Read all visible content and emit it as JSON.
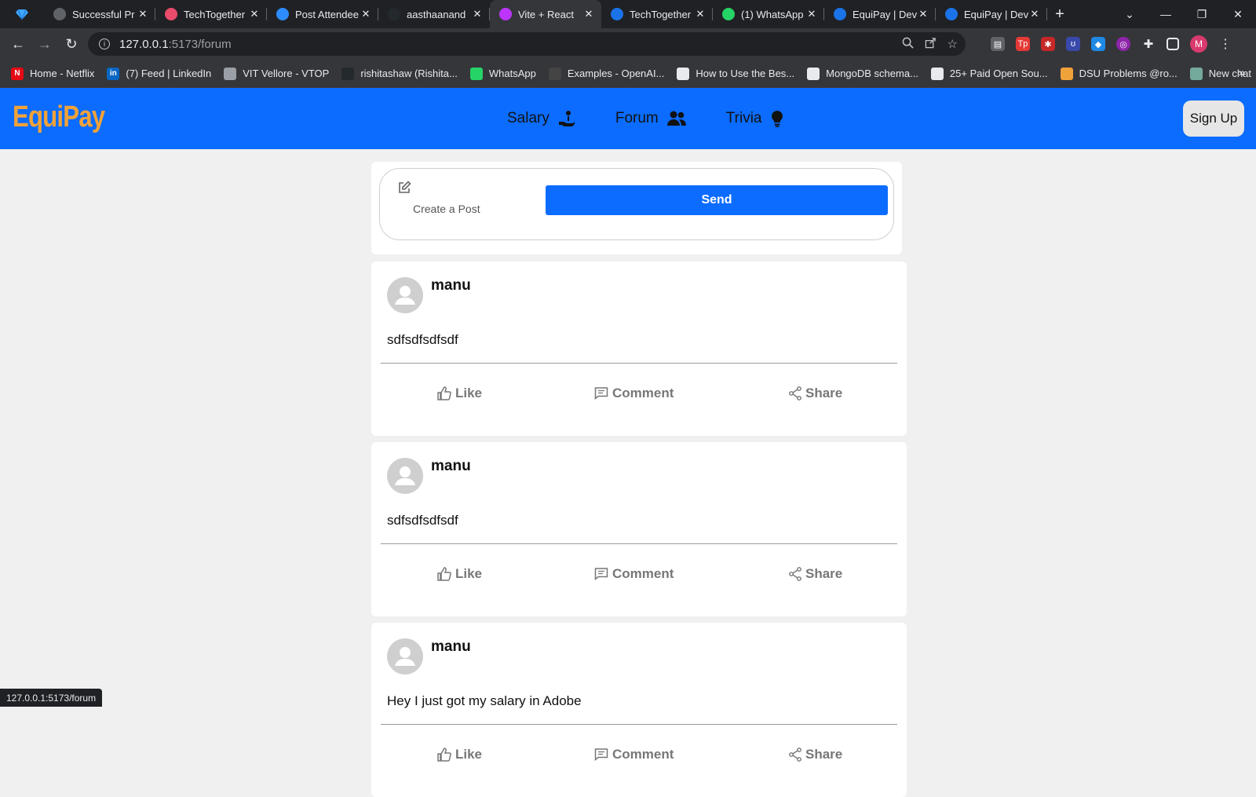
{
  "browser": {
    "tabs": [
      {
        "title": "Successful Pr",
        "fav_color": "#5f6368",
        "icon": "globe-icon"
      },
      {
        "title": "TechTogether",
        "fav_color": "#e94b6a",
        "icon": "techtogether-icon"
      },
      {
        "title": "Post Attendee",
        "fav_color": "#2d8cff",
        "icon": "zoom-icon"
      },
      {
        "title": "aasthaanand",
        "fav_color": "#24292e",
        "icon": "github-icon"
      },
      {
        "title": "Vite + React",
        "fav_color": "#bd34fe",
        "icon": "vite-icon",
        "active": true
      },
      {
        "title": "TechTogether",
        "fav_color": "#1a73e8",
        "icon": "devpost-icon"
      },
      {
        "title": "(1) WhatsApp",
        "fav_color": "#25d366",
        "icon": "whatsapp-icon"
      },
      {
        "title": "EquiPay | Dev",
        "fav_color": "#1a73e8",
        "icon": "devpost-icon"
      },
      {
        "title": "EquiPay | Dev",
        "fav_color": "#1a73e8",
        "icon": "devpost-icon"
      }
    ],
    "url_host": "127.0.0.1",
    "url_path": ":5173/forum",
    "bookmarks": [
      {
        "label": "Home - Netflix",
        "fav_color": "#e50914",
        "fav_text": "N"
      },
      {
        "label": "(7) Feed | LinkedIn",
        "fav_color": "#0a66c2",
        "fav_text": "in"
      },
      {
        "label": "VIT Vellore - VTOP",
        "fav_color": "#9aa0a6",
        "fav_text": ""
      },
      {
        "label": "rishitashaw (Rishita...",
        "fav_color": "#24292e",
        "fav_text": ""
      },
      {
        "label": "WhatsApp",
        "fav_color": "#25d366",
        "fav_text": ""
      },
      {
        "label": "Examples - OpenAI...",
        "fav_color": "#444",
        "fav_text": ""
      },
      {
        "label": "How to Use the Bes...",
        "fav_color": "#e8eaed",
        "fav_text": ""
      },
      {
        "label": "MongoDB schema...",
        "fav_color": "#e8eaed",
        "fav_text": ""
      },
      {
        "label": "25+ Paid Open Sou...",
        "fav_color": "#e8eaed",
        "fav_text": ""
      },
      {
        "label": "DSU Problems @ro...",
        "fav_color": "#f0a23a",
        "fav_text": ""
      },
      {
        "label": "New chat",
        "fav_color": "#74aa9c",
        "fav_text": ""
      }
    ],
    "profile_initial": "M",
    "status_url": "127.0.0.1:5173/forum"
  },
  "app": {
    "logo": "EquiPay",
    "nav": [
      {
        "label": "Salary",
        "icon": "hand-coin-icon"
      },
      {
        "label": "Forum",
        "icon": "users-icon"
      },
      {
        "label": "Trivia",
        "icon": "lightbulb-icon"
      }
    ],
    "signup_label": "Sign Up",
    "brand_color": "#0b6cff",
    "logo_color": "#f0a23a"
  },
  "composer": {
    "placeholder": "Create a Post",
    "send_label": "Send"
  },
  "posts": [
    {
      "author": "manu",
      "body": "sdfsdfsdfsdf"
    },
    {
      "author": "manu",
      "body": "sdfsdfsdfsdf"
    },
    {
      "author": "manu",
      "body": "Hey I just got my salary in Adobe"
    }
  ],
  "actions": {
    "like": "Like",
    "comment": "Comment",
    "share": "Share"
  }
}
